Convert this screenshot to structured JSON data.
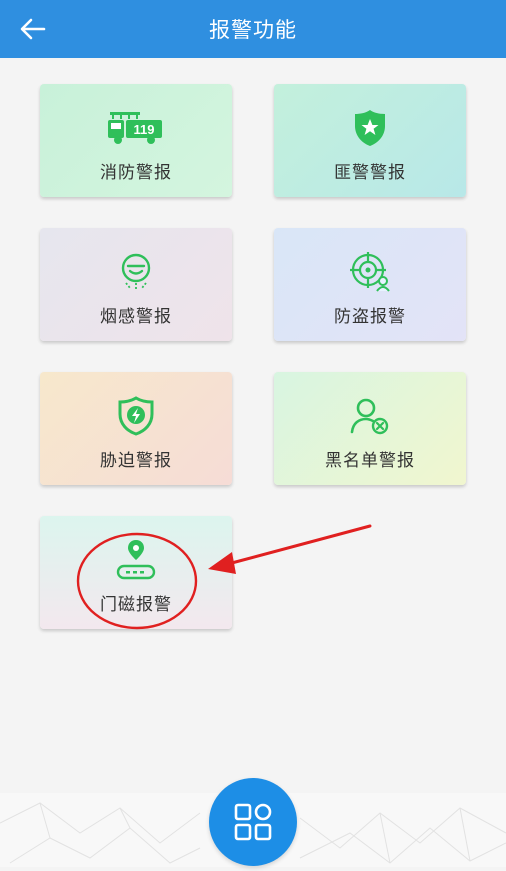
{
  "header": {
    "title": "报警功能",
    "back_icon": "arrow-left-icon"
  },
  "cards": [
    {
      "label": "消防警报",
      "icon": "fire-truck-icon",
      "icon_text": "119"
    },
    {
      "label": "匪警警报",
      "icon": "police-shield-icon"
    },
    {
      "label": "烟感警报",
      "icon": "smoke-detector-icon"
    },
    {
      "label": "防盗报警",
      "icon": "anti-theft-target-icon"
    },
    {
      "label": "胁迫警报",
      "icon": "duress-shield-icon"
    },
    {
      "label": "黑名单警报",
      "icon": "blacklist-user-icon"
    },
    {
      "label": "门磁报警",
      "icon": "door-sensor-icon"
    }
  ],
  "bottom": {
    "menu_icon": "grid-menu-icon"
  },
  "colors": {
    "header": "#2f8fe0",
    "icon_green": "#2fbf5a",
    "annotation_red": "#e02020",
    "fab": "#1d8ee6"
  }
}
